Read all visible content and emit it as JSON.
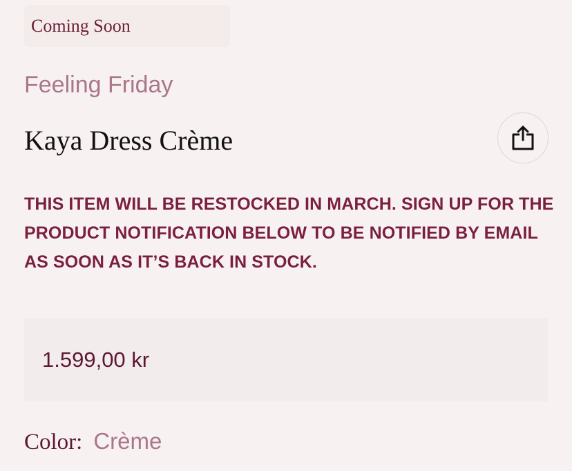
{
  "badge": {
    "label": "Coming Soon"
  },
  "product": {
    "brand": "Feeling Friday",
    "name": "Kaya Dress Crème",
    "notice": "THIS ITEM WILL BE RESTOCKED IN MARCH. SIGN UP FOR THE PRODUCT NOTIFICATION BELOW TO BE NOTIFIED BY EMAIL AS SOON AS IT’S BACK IN STOCK.",
    "price": "1.599,00 kr",
    "color_label": "Color:",
    "color_value": "Crème"
  },
  "share": {
    "icon": "share-icon"
  },
  "colors": {
    "background": "#f8f1f2",
    "accent": "#7a1f40",
    "muted": "#a9768a",
    "price_box": "#f2ecec"
  }
}
